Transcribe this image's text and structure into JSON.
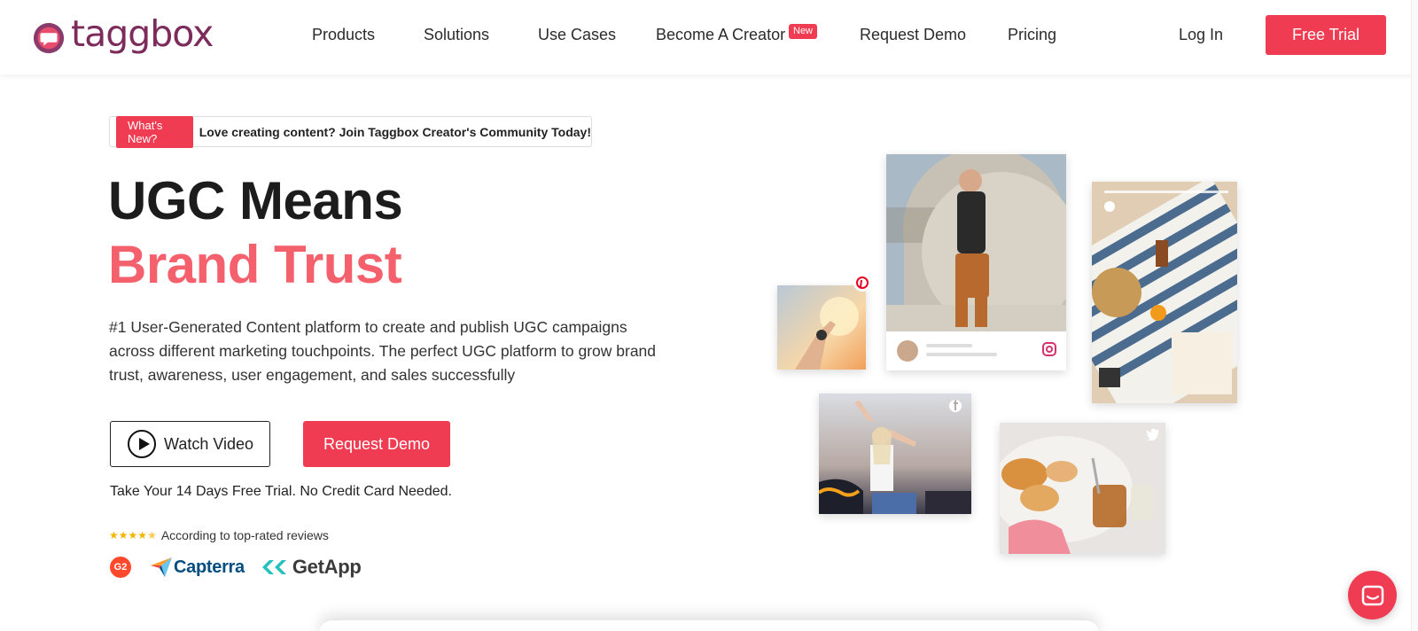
{
  "header": {
    "brand": "taggbox",
    "nav": [
      {
        "label": "Products"
      },
      {
        "label": "Solutions"
      },
      {
        "label": "Use Cases"
      },
      {
        "label": "Become A Creator"
      },
      {
        "label": "Request Demo"
      },
      {
        "label": "Pricing"
      }
    ],
    "creator_badge": "New",
    "login_label": "Log In",
    "free_trial_label": "Free Trial"
  },
  "announcement": {
    "tag": "What's New?",
    "text": "Love creating content? Join Taggbox Creator's Community Today!"
  },
  "hero": {
    "title_line1": "UGC Means",
    "title_line2": "Brand Trust",
    "description": "#1 User-Generated Content platform to create and publish UGC campaigns across different marketing touchpoints. The perfect UGC platform to grow brand trust, awareness, user engagement, and sales successfully",
    "watch_video_label": "Watch Video",
    "request_demo_label": "Request Demo",
    "trial_note": "Take Your 14 Days Free Trial. No Credit Card Needed.",
    "rating_stars": 4.5,
    "rating_text": "According to top-rated reviews",
    "review_sites": [
      "G2",
      "Capterra",
      "GetApp"
    ]
  },
  "collage": {
    "networks": [
      "pinterest-icon",
      "instagram-icon",
      "facebook-icon",
      "twitter-icon"
    ]
  },
  "colors": {
    "brand_red": "#f03c52",
    "title_pink": "#f4606c",
    "logo_purple": "#7c2b5a"
  }
}
